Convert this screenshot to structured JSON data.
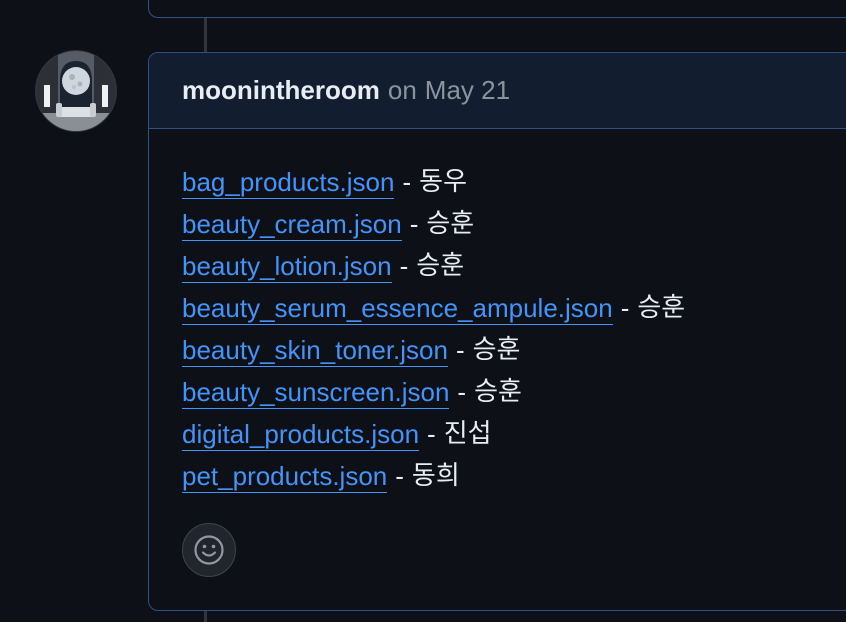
{
  "comment": {
    "author": "moonintheroom",
    "on_word": "on",
    "date": "May 21",
    "files": [
      {
        "name": "bag_products.json",
        "separator": "-",
        "assignee": "동우"
      },
      {
        "name": "beauty_cream.json",
        "separator": "-",
        "assignee": "승훈"
      },
      {
        "name": "beauty_lotion.json",
        "separator": "-",
        "assignee": "승훈"
      },
      {
        "name": "beauty_serum_essence_ampule.json",
        "separator": "-",
        "assignee": "승훈"
      },
      {
        "name": "beauty_skin_toner.json",
        "separator": "-",
        "assignee": "승훈"
      },
      {
        "name": "beauty_sunscreen.json",
        "separator": "-",
        "assignee": "승훈"
      },
      {
        "name": "digital_products.json",
        "separator": "-",
        "assignee": "진섭"
      },
      {
        "name": "pet_products.json",
        "separator": "-",
        "assignee": "동희"
      }
    ]
  },
  "icons": {
    "avatar": "moon-room-avatar",
    "reaction": "smiley-icon"
  },
  "colors": {
    "background": "#0d1117",
    "header_bg": "#121d2f",
    "border_accent": "#2f4f85",
    "link": "#4493f8",
    "text": "#e6edf3",
    "muted": "#8b949e"
  }
}
